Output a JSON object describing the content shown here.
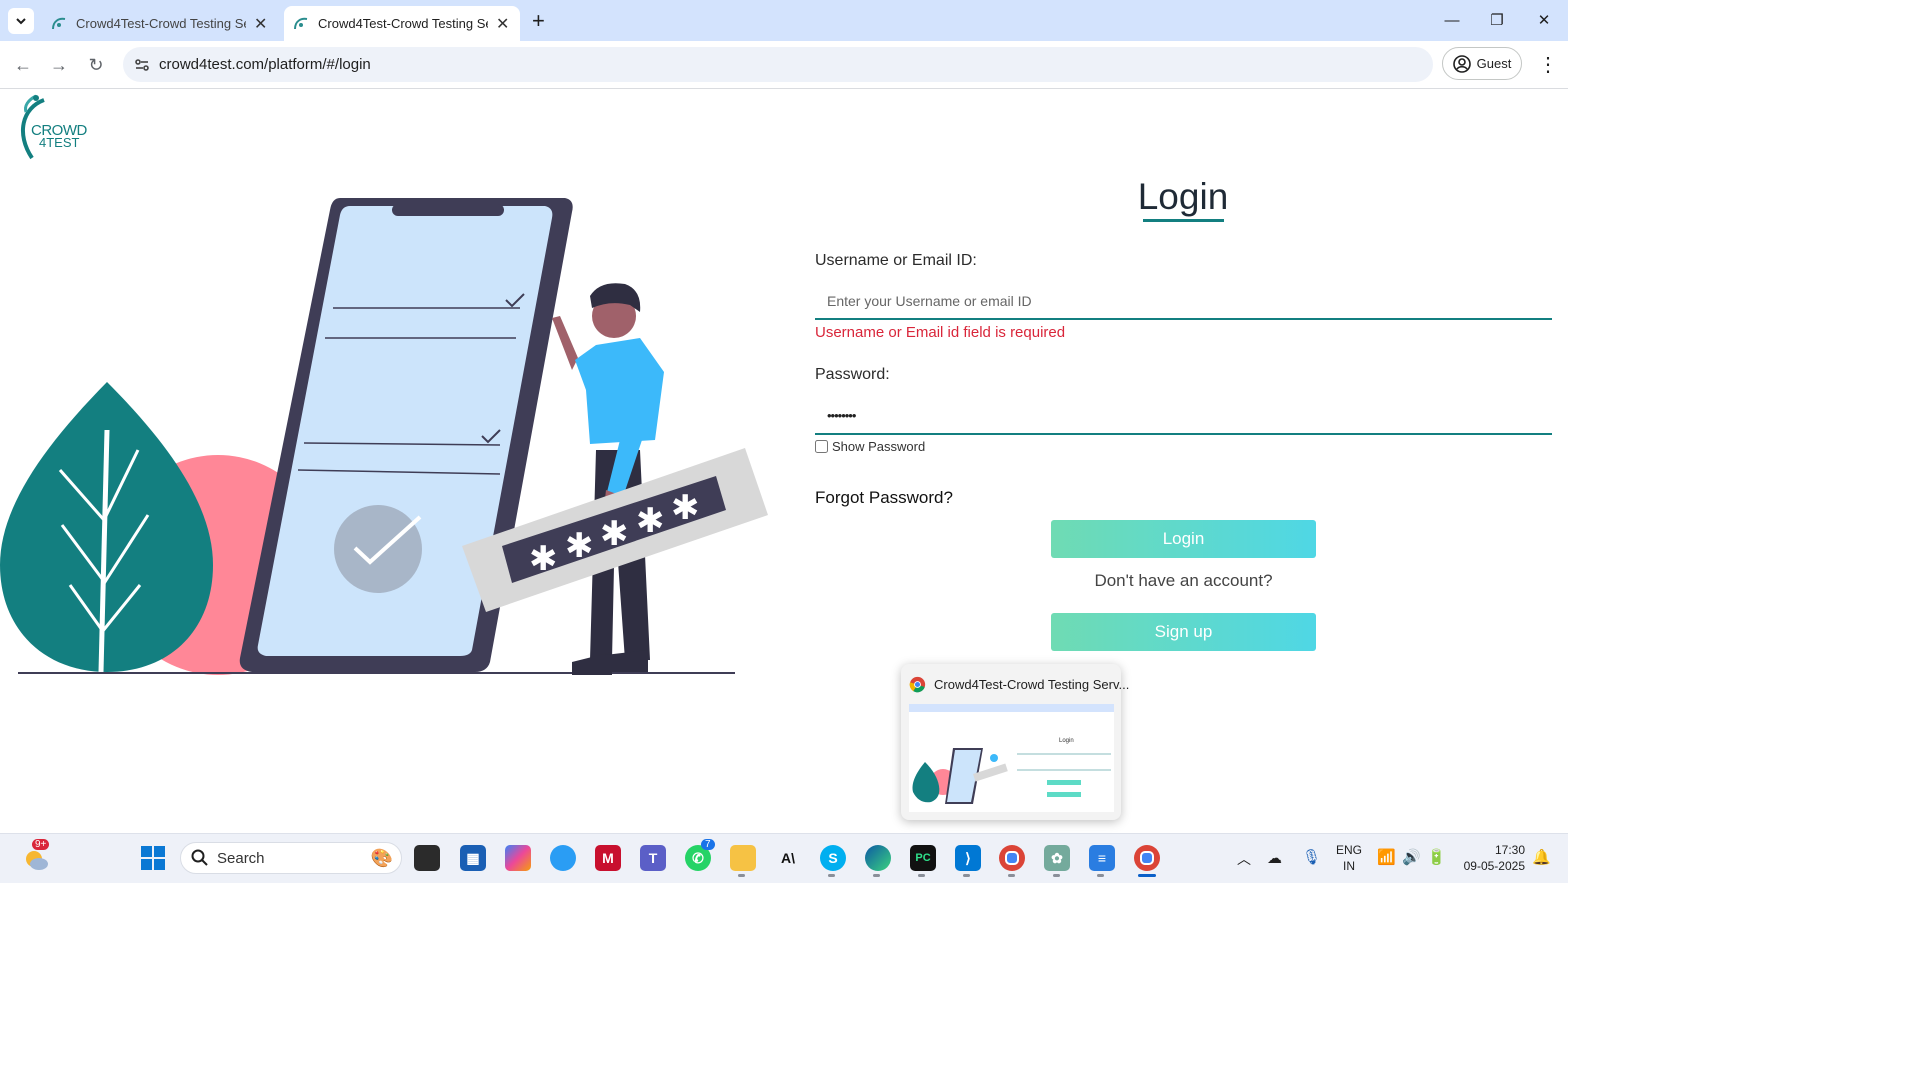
{
  "browser": {
    "tabs": [
      {
        "title": "Crowd4Test-Crowd Testing Serv",
        "active": false
      },
      {
        "title": "Crowd4Test-Crowd Testing Serv",
        "active": true
      }
    ],
    "new_tab": "+",
    "url": "crowd4test.com/platform/#/login",
    "profile_label": "Guest"
  },
  "brand": {
    "line1": "CROWD",
    "line2": "4TEST"
  },
  "login": {
    "title": "Login",
    "username_label": "Username or Email ID:",
    "username_placeholder": "Enter your Username or email ID",
    "username_value": "",
    "username_error": "Username or Email id field is required",
    "password_label": "Password:",
    "password_value": "••••••••",
    "show_password_label": "Show Password",
    "forgot_password": "Forgot Password?",
    "login_button": "Login",
    "no_account_text": "Don't have an account?",
    "signup_button": "Sign up"
  },
  "hover_preview": {
    "title": "Crowd4Test-Crowd Testing Serv...",
    "mini_title": "Login"
  },
  "taskbar": {
    "search_label": "Search",
    "weather_badge": "9+",
    "whatsapp_badge": "7",
    "language_line1": "ENG",
    "language_line2": "IN",
    "time": "17:30",
    "date": "09-05-2025"
  },
  "colors": {
    "accent": "#137f80",
    "error": "#d9263a",
    "button_start": "#6fdbb3",
    "button_end": "#4fd7e5",
    "tabbar": "#d3e3fd"
  }
}
